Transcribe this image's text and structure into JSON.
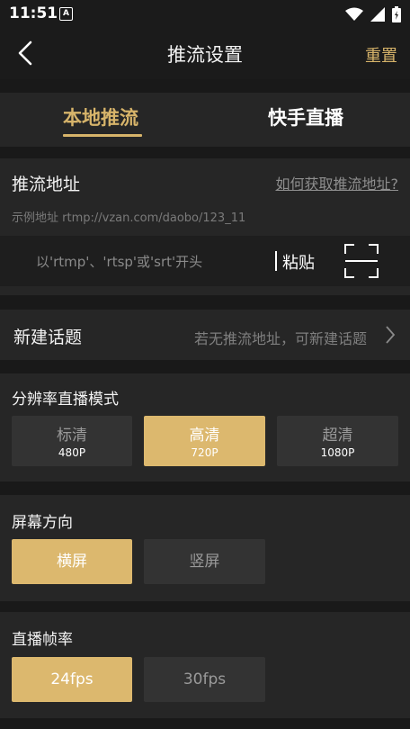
{
  "status_bar": {
    "time": "11:51",
    "badge": "A"
  },
  "nav": {
    "title": "推流设置",
    "reset_label": "重置"
  },
  "tabs": [
    {
      "label": "本地推流",
      "active": true
    },
    {
      "label": "快手直播",
      "active": false
    }
  ],
  "push": {
    "title": "推流地址",
    "help_link": "如何获取推流地址?",
    "example": "示例地址 rtmp://vzan.com/daobo/123_11",
    "placeholder": "以'rtmp'、'rtsp'或'srt'开头",
    "value": "",
    "paste_label": "粘贴"
  },
  "topic": {
    "title": "新建话题",
    "hint": "若无推流地址，可新建话题"
  },
  "resolution": {
    "title": "分辨率直播模式",
    "options": [
      {
        "label": "标清",
        "sub": "480P",
        "selected": false
      },
      {
        "label": "高清",
        "sub": "720P",
        "selected": true
      },
      {
        "label": "超清",
        "sub": "1080P",
        "selected": false
      }
    ]
  },
  "orientation": {
    "title": "屏幕方向",
    "options": [
      {
        "label": "横屏",
        "selected": true
      },
      {
        "label": "竖屏",
        "selected": false
      }
    ]
  },
  "framerate": {
    "title": "直播帧率",
    "options": [
      {
        "label": "24fps",
        "selected": true
      },
      {
        "label": "30fps",
        "selected": false
      }
    ]
  },
  "colors": {
    "accent": "#dcb86e",
    "background": "#191919",
    "panel": "#262626",
    "option": "#333333"
  }
}
